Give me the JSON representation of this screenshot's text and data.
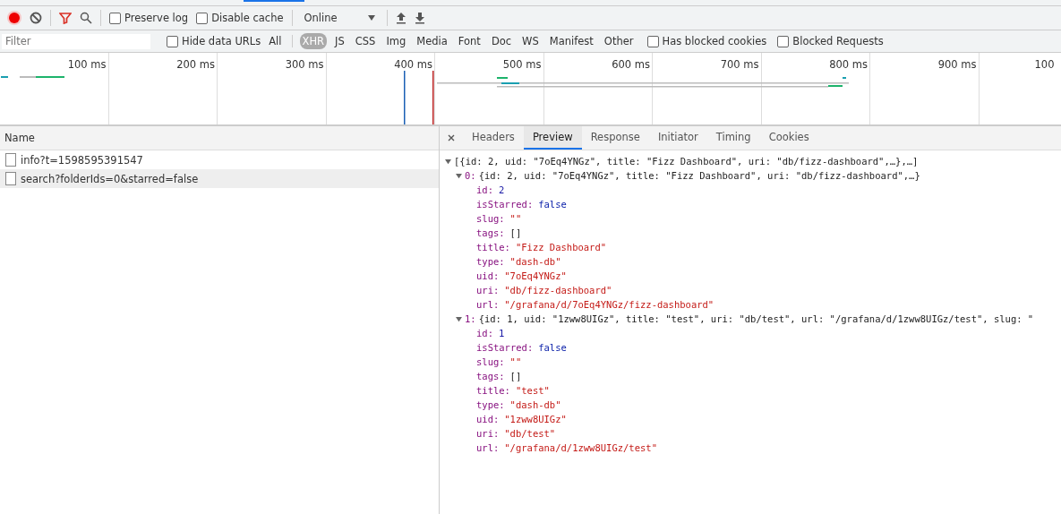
{
  "toolbar": {
    "recording": true,
    "preserve_log": {
      "label": "Preserve log",
      "checked": false
    },
    "disable_cache": {
      "label": "Disable cache",
      "checked": false
    },
    "throttling": "Online"
  },
  "filter_bar": {
    "placeholder": "Filter",
    "hide_data_urls": {
      "label": "Hide data URLs",
      "checked": false
    },
    "types": [
      {
        "label": "All",
        "selected": false
      },
      {
        "label": "XHR",
        "selected": true
      },
      {
        "label": "JS",
        "selected": false
      },
      {
        "label": "CSS",
        "selected": false
      },
      {
        "label": "Img",
        "selected": false
      },
      {
        "label": "Media",
        "selected": false
      },
      {
        "label": "Font",
        "selected": false
      },
      {
        "label": "Doc",
        "selected": false
      },
      {
        "label": "WS",
        "selected": false
      },
      {
        "label": "Manifest",
        "selected": false
      },
      {
        "label": "Other",
        "selected": false
      }
    ],
    "options": [
      {
        "label": "Has blocked cookies",
        "checked": false
      },
      {
        "label": "Blocked Requests",
        "checked": false
      }
    ]
  },
  "timeline": {
    "ticks": [
      "100 ms",
      "200 ms",
      "300 ms",
      "400 ms",
      "500 ms",
      "600 ms",
      "700 ms",
      "800 ms",
      "900 ms",
      "100"
    ]
  },
  "requests": {
    "column": "Name",
    "rows": [
      {
        "name": "info?t=1598595391547",
        "selected": false
      },
      {
        "name": "search?folderIds=0&starred=false",
        "selected": true
      }
    ]
  },
  "details": {
    "tabs": [
      {
        "label": "Headers",
        "selected": false
      },
      {
        "label": "Preview",
        "selected": true
      },
      {
        "label": "Response",
        "selected": false
      },
      {
        "label": "Initiator",
        "selected": false
      },
      {
        "label": "Timing",
        "selected": false
      },
      {
        "label": "Cookies",
        "selected": false
      }
    ],
    "preview": {
      "summary": "[{id: 2, uid: \"7oEq4YNGz\", title: \"Fizz Dashboard\", uri: \"db/fizz-dashboard\",…},…]",
      "expanded": true,
      "items": [
        {
          "index": "0:",
          "summary": "{id: 2, uid: \"7oEq4YNGz\", title: \"Fizz Dashboard\", uri: \"db/fizz-dashboard\",…}",
          "expanded": true,
          "props": [
            {
              "key": "id:",
              "value": "2",
              "kind": "number"
            },
            {
              "key": "isStarred:",
              "value": "false",
              "kind": "boolean"
            },
            {
              "key": "slug:",
              "value": "\"\"",
              "kind": "string"
            },
            {
              "key": "tags:",
              "value": "[]",
              "kind": "array"
            },
            {
              "key": "title:",
              "value": "\"Fizz Dashboard\"",
              "kind": "string"
            },
            {
              "key": "type:",
              "value": "\"dash-db\"",
              "kind": "string"
            },
            {
              "key": "uid:",
              "value": "\"7oEq4YNGz\"",
              "kind": "string"
            },
            {
              "key": "uri:",
              "value": "\"db/fizz-dashboard\"",
              "kind": "string"
            },
            {
              "key": "url:",
              "value": "\"/grafana/d/7oEq4YNGz/fizz-dashboard\"",
              "kind": "string"
            }
          ]
        },
        {
          "index": "1:",
          "summary": "{id: 1, uid: \"1zww8UIGz\", title: \"test\", uri: \"db/test\", url: \"/grafana/d/1zww8UIGz/test\", slug: \"",
          "expanded": true,
          "props": [
            {
              "key": "id:",
              "value": "1",
              "kind": "number"
            },
            {
              "key": "isStarred:",
              "value": "false",
              "kind": "boolean"
            },
            {
              "key": "slug:",
              "value": "\"\"",
              "kind": "string"
            },
            {
              "key": "tags:",
              "value": "[]",
              "kind": "array"
            },
            {
              "key": "title:",
              "value": "\"test\"",
              "kind": "string"
            },
            {
              "key": "type:",
              "value": "\"dash-db\"",
              "kind": "string"
            },
            {
              "key": "uid:",
              "value": "\"1zww8UIGz\"",
              "kind": "string"
            },
            {
              "key": "uri:",
              "value": "\"db/test\"",
              "kind": "string"
            },
            {
              "key": "url:",
              "value": "\"/grafana/d/1zww8UIGz/test\"",
              "kind": "string"
            }
          ]
        }
      ]
    }
  }
}
